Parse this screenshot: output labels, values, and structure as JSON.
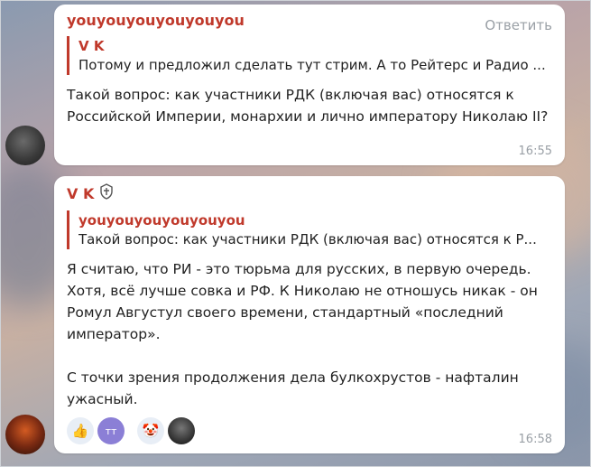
{
  "messages": [
    {
      "sender": "youyouyouyouyouyou",
      "reply_action": "Ответить",
      "quote_author": "V K",
      "quote_text": "Потому и предложил сделать тут стрим. А то Рейтерс и Радио ...",
      "text": "Такой вопрос: как участники РДК (включая вас) относятся к Российской Империи, монархии и лично императору Николаю II?",
      "time": "16:55"
    },
    {
      "sender": "V K",
      "quote_author": "youyouyouyouyouyou",
      "quote_text": "Такой вопрос: как участники РДК (включая вас) относятся к Р...",
      "text": "Я считаю, что РИ - это тюрьма для русских, в первую очередь. Хотя, всё лучше совка и РФ. К Николаю не отношусь никак - он Ромул Августул своего времени, стандартный «последний император».\n\nС точки зрения продолжения дела булкохрустов - нафталин ужасный.",
      "time": "16:58",
      "reactions": [
        {
          "icon": "thumbs-up",
          "glyph": "👍"
        },
        {
          "icon": "avatar-tt",
          "glyph": "тт"
        },
        {
          "icon": "clown-face",
          "glyph": "🤡"
        },
        {
          "icon": "avatar-dark",
          "glyph": ""
        }
      ]
    }
  ]
}
